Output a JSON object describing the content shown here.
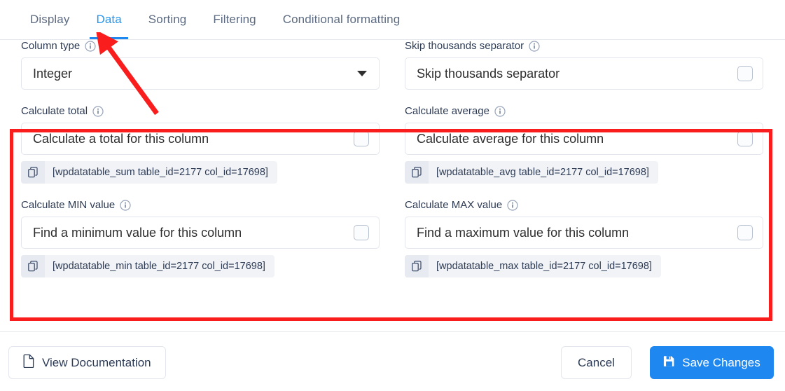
{
  "tabs": [
    {
      "label": "Display",
      "active": false
    },
    {
      "label": "Data",
      "active": true
    },
    {
      "label": "Sorting",
      "active": false
    },
    {
      "label": "Filtering",
      "active": false
    },
    {
      "label": "Conditional formatting",
      "active": false
    }
  ],
  "fields": {
    "column_type": {
      "label": "Column type",
      "value": "Integer",
      "control": "select"
    },
    "skip_thousands_separator": {
      "label": "Skip thousands separator",
      "value": "Skip thousands separator",
      "checked": false,
      "control": "checkbox"
    },
    "calculate_total": {
      "label": "Calculate total",
      "value": "Calculate a total for this column",
      "checked": false,
      "shortcode": "[wpdatatable_sum table_id=2177 col_id=17698]"
    },
    "calculate_average": {
      "label": "Calculate average",
      "value": "Calculate average for this column",
      "checked": false,
      "shortcode": "[wpdatatable_avg table_id=2177 col_id=17698]"
    },
    "calculate_min": {
      "label": "Calculate MIN value",
      "value": "Find a minimum value for this column",
      "checked": false,
      "shortcode": "[wpdatatable_min table_id=2177 col_id=17698]"
    },
    "calculate_max": {
      "label": "Calculate MAX value",
      "value": "Find a maximum value for this column",
      "checked": false,
      "shortcode": "[wpdatatable_max table_id=2177 col_id=17698]"
    }
  },
  "footer": {
    "view_documentation": "View Documentation",
    "cancel": "Cancel",
    "save_changes": "Save Changes"
  },
  "colors": {
    "accent_blue": "#1e88f0",
    "annotation_red": "#fa1d1d",
    "label_text": "#2d3b55",
    "tab_inactive": "#5c6b82"
  }
}
